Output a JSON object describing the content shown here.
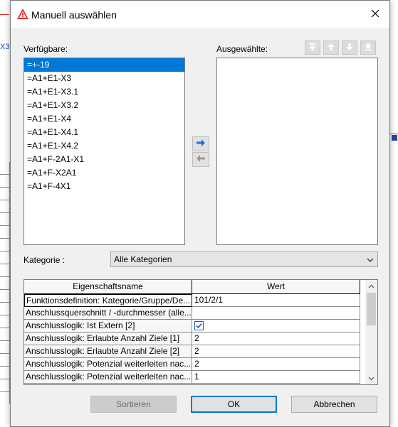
{
  "dialog": {
    "title": "Manuell auswählen",
    "close_symbol": "✕",
    "icon": "warning-triangle-icon"
  },
  "background": {
    "left_fragment_text": "X3"
  },
  "available": {
    "label": "Verfügbare:",
    "items": [
      "=+-19",
      "=A1+E1-X3",
      "=A1+E1-X3.1",
      "=A1+E1-X3.2",
      "=A1+E1-X4",
      "=A1+E1-X4.1",
      "=A1+E1-X4.2",
      "=A1+F-2A1-X1",
      "=A1+F-X2A1",
      "=A1+F-4X1"
    ],
    "selected_index": 0
  },
  "selected": {
    "label": "Ausgewählte:",
    "items": []
  },
  "toolbar": {
    "icons": [
      "move-to-top-icon",
      "move-up-icon",
      "move-down-icon",
      "move-to-bottom-icon"
    ]
  },
  "transfer": {
    "icons": [
      "arrow-right-icon",
      "arrow-left-icon"
    ]
  },
  "category": {
    "label": "Kategorie :",
    "value": "Alle Kategorien"
  },
  "properties": {
    "headers": [
      "Eigenschaftsname",
      "Wert"
    ],
    "rows": [
      {
        "name": "Funktionsdefinition: Kategorie/Gruppe/De...",
        "value": "101/2/1"
      },
      {
        "name": "Anschlussquerschnitt / -durchmesser (alle...",
        "value": ""
      },
      {
        "name": "Anschlusslogik: Ist Extern [2]",
        "value": "",
        "checkbox": true,
        "checked": true
      },
      {
        "name": "Anschlusslogik: Erlaubte Anzahl Ziele [1]",
        "value": "2"
      },
      {
        "name": "Anschlusslogik: Erlaubte Anzahl Ziele [2]",
        "value": "2"
      },
      {
        "name": "Anschlusslogik: Potenzial weiterleiten nac...",
        "value": "2"
      },
      {
        "name": "Anschlusslogik: Potenzial weiterleiten nac...",
        "value": "1"
      }
    ]
  },
  "buttons": {
    "sort": "Sortieren",
    "ok": "OK",
    "cancel": "Abbrechen"
  },
  "colors": {
    "selection": "#0078d7",
    "dialog_bg": "#f0f0f0",
    "title_icon_red": "#e0302a"
  }
}
